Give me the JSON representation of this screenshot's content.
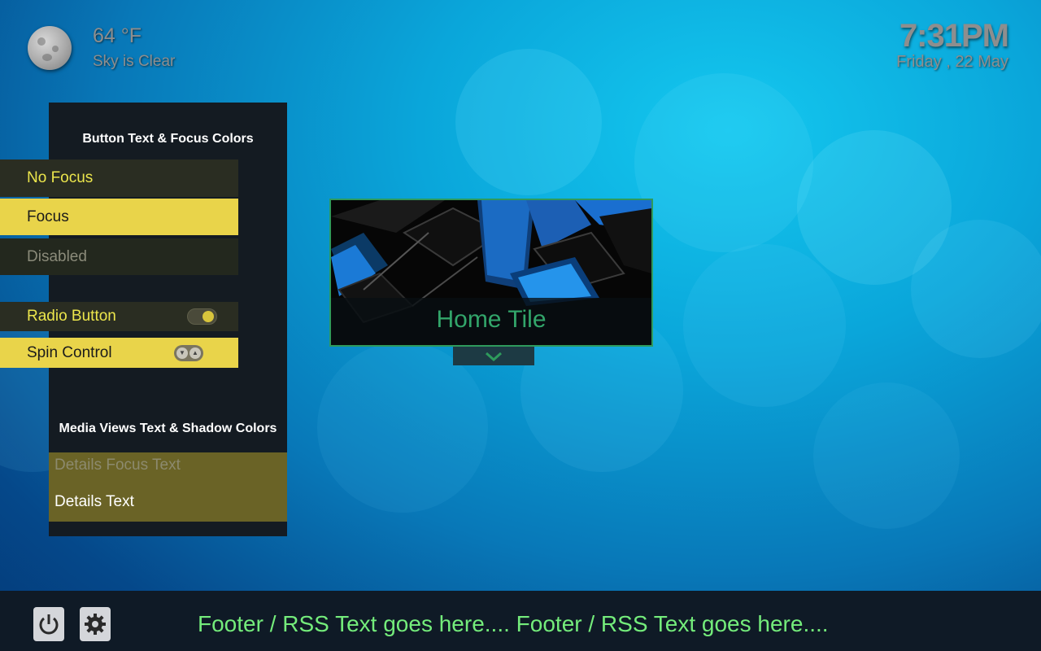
{
  "weather": {
    "temperature": "64 °F",
    "condition": "Sky is Clear",
    "icon": "moon-icon"
  },
  "clock": {
    "time": "7:31PM",
    "date": "Friday , 22 May"
  },
  "panel": {
    "button_heading": "Button Text & Focus Colors",
    "buttons": {
      "no_focus": "No Focus",
      "focus": "Focus",
      "disabled": "Disabled",
      "radio": "Radio Button",
      "spin": "Spin Control"
    },
    "media_heading": "Media Views Text & Shadow Colors",
    "details_focus_text": "Details Focus Text",
    "details_text": "Details Text"
  },
  "home_tile": {
    "label": "Home Tile"
  },
  "footer": {
    "rss_text": "Footer / RSS Text goes here....  Footer / RSS Text goes here....",
    "power_icon": "power-icon",
    "settings_icon": "gear-icon"
  },
  "colors": {
    "focus_yellow": "#e9d44a",
    "text_yellow": "#ece64c",
    "tile_border": "#2e9a5c",
    "footer_green": "#74ec7b"
  }
}
